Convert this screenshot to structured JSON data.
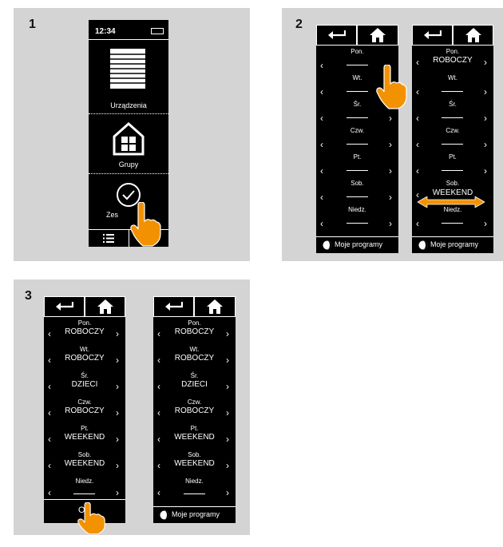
{
  "steps": {
    "one": "1",
    "two": "2",
    "three": "3"
  },
  "step1": {
    "time": "12:34",
    "menu": [
      "Urządzenia",
      "Grupy",
      "Zes"
    ]
  },
  "step2": {
    "left_days": [
      "Pon.",
      "Wt.",
      "Śr.",
      "Czw.",
      "Pt.",
      "Sob.",
      "Niedz."
    ],
    "right_days": [
      "Pon.",
      "Wt.",
      "Śr.",
      "Czw.",
      "Pt.",
      "Sob.",
      "Niedz."
    ],
    "right_value_mon": "ROBOCZY",
    "right_value_sat": "WEEKEND",
    "footer": "Moje programy"
  },
  "step3": {
    "days": [
      "Pon.",
      "Wt.",
      "Śr.",
      "Czw.",
      "Pt.",
      "Sob.",
      "Niedz."
    ],
    "values": [
      "ROBOCZY",
      "ROBOCZY",
      "DZIECI",
      "ROBOCZY",
      "WEEKEND",
      "WEEKEND",
      ""
    ],
    "ok": "OK",
    "footer": "Moje programy"
  },
  "colors": {
    "accent": "#f39200",
    "panel": "#d4d4d4",
    "device": "#000000"
  },
  "icons": [
    "back-arrow-icon",
    "home-icon",
    "blinds-icon",
    "house-icon",
    "check-circle-icon",
    "list-icon",
    "moon-icon",
    "hand-pointer-icon",
    "double-arrow-icon"
  ]
}
